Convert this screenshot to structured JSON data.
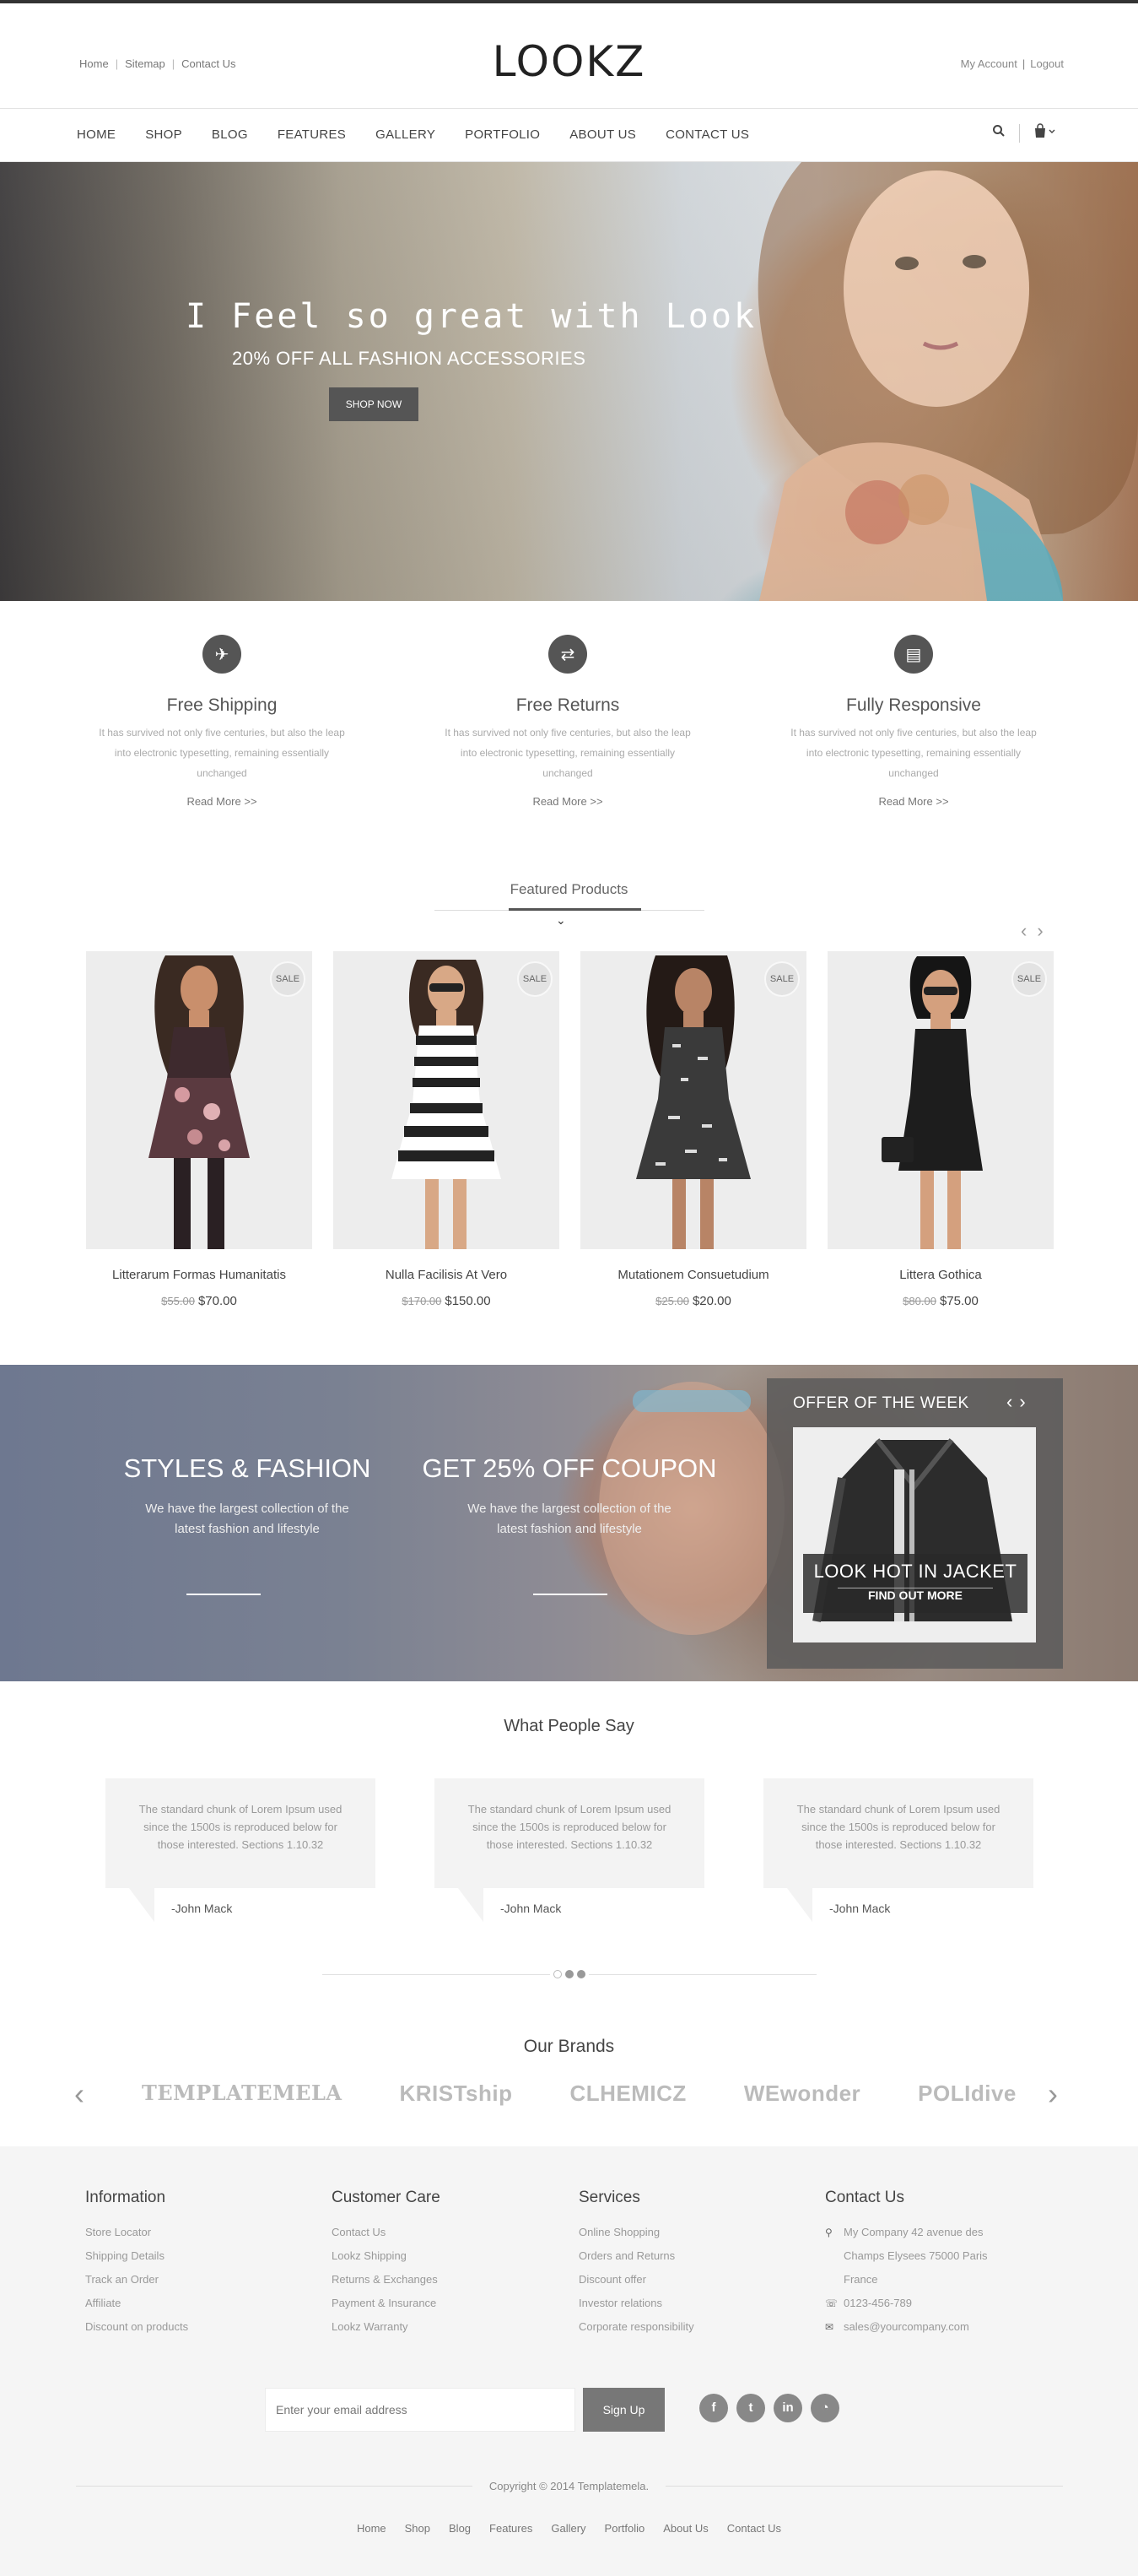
{
  "header": {
    "top_links": [
      "Home",
      "Sitemap",
      "Contact Us"
    ],
    "logo": "LOOKZ",
    "account_links": [
      "My Account",
      "Logout"
    ]
  },
  "nav": {
    "items": [
      "HOME",
      "SHOP",
      "BLOG",
      "FEATURES",
      "GALLERY",
      "PORTFOLIO",
      "ABOUT US",
      "CONTACT US"
    ],
    "icons": [
      "search-icon",
      "cart-icon"
    ]
  },
  "hero": {
    "title": "I Feel so great with Look",
    "subtitle": "20% OFF ALL FASHION ACCESSORIES",
    "button": "SHOP NOW"
  },
  "features": [
    {
      "icon": "plane-icon",
      "title": "Free Shipping",
      "text": "It has survived not only five centuries, but also the leap into electronic typesetting, remaining essentially unchanged",
      "link": "Read More  >>"
    },
    {
      "icon": "shuffle-icon",
      "title": "Free Returns",
      "text": "It has survived not only five centuries, but also the leap into electronic typesetting, remaining essentially unchanged",
      "link": "Read More  >>"
    },
    {
      "icon": "document-icon",
      "title": "Fully Responsive",
      "text": "It has survived not only five centuries, but also the leap into electronic typesetting, remaining essentially unchanged",
      "link": "Read More  >>"
    }
  ],
  "featured": {
    "title": "Featured Products",
    "badge": "SALE",
    "products": [
      {
        "name": "Litterarum Formas Humanitatis",
        "old_price": "$55.00",
        "price": "$70.00"
      },
      {
        "name": "Nulla Facilisis At Vero",
        "old_price": "$170.00",
        "price": "$150.00"
      },
      {
        "name": "Mutationem Consuetudium",
        "old_price": "$25.00",
        "price": "$20.00"
      },
      {
        "name": "Littera Gothica",
        "old_price": "$80.00",
        "price": "$75.00"
      }
    ]
  },
  "banner": {
    "left": {
      "title": "STYLES & FASHION",
      "text": "We have the largest collection of the latest fashion and lifestyle"
    },
    "middle": {
      "title": "GET 25% OFF COUPON",
      "text": "We have the largest collection of the latest fashion and lifestyle"
    },
    "offer": {
      "title": "OFFER OF THE WEEK",
      "caption": "LOOK HOT IN JACKET",
      "button": "FIND OUT MORE"
    }
  },
  "testimonials": {
    "title": "What People Say",
    "items": [
      {
        "text": "The standard chunk of Lorem Ipsum used since the 1500s is reproduced below for those interested. Sections 1.10.32",
        "author": "-John Mack"
      },
      {
        "text": "The standard chunk of Lorem Ipsum used since the 1500s is reproduced below for those interested. Sections 1.10.32",
        "author": "-John Mack"
      },
      {
        "text": "The standard chunk of Lorem Ipsum used since the 1500s is reproduced below for those interested. Sections 1.10.32",
        "author": "-John Mack"
      }
    ]
  },
  "brands": {
    "title": "Our Brands",
    "items": [
      "TEMPLATEMELA",
      "KRISTship",
      "CLHEMICZ",
      "WEwonder",
      "POLIdive"
    ]
  },
  "footer": {
    "information": {
      "title": "Information",
      "links": [
        "Store Locator",
        "Shipping Details",
        "Track an Order",
        "Affiliate",
        "Discount on products"
      ]
    },
    "care": {
      "title": "Customer Care",
      "links": [
        "Contact Us",
        "Lookz Shipping",
        "Returns & Exchanges",
        "Payment & Insurance",
        "Lookz Warranty"
      ]
    },
    "services": {
      "title": "Services",
      "links": [
        "Online Shopping",
        "Orders and Returns",
        "Discount offer",
        "Investor relations",
        "Corporate responsibility"
      ]
    },
    "contact": {
      "title": "Contact Us",
      "address1": "My Company 42 avenue des",
      "address2": "Champs Elysees 75000 Paris",
      "address3": "France",
      "phone": "0123-456-789",
      "email": "sales@yourcompany.com"
    },
    "newsletter": {
      "placeholder": "Enter your email address",
      "button": "Sign Up"
    },
    "social": [
      "facebook-icon",
      "twitter-icon",
      "linkedin-icon",
      "rss-icon"
    ],
    "copyright": "Copyright © 2014 Templatemela.",
    "nav": [
      "Home",
      "Shop",
      "Blog",
      "Features",
      "Gallery",
      "Portfolio",
      "About Us",
      "Contact Us"
    ]
  },
  "colors": {
    "accent": "#555555",
    "footer_bg": "#f5f5f5",
    "text": "#444444"
  }
}
